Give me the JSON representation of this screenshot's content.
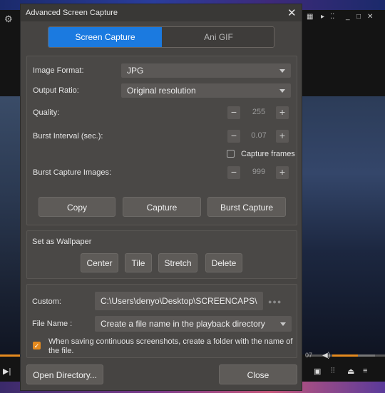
{
  "dialog": {
    "title": "Advanced Screen Capture",
    "close_glyph": "✕"
  },
  "tabs": [
    {
      "label": "Screen Capture",
      "active": true
    },
    {
      "label": "Ani GIF",
      "active": false
    }
  ],
  "capture": {
    "image_format_label": "Image Format:",
    "image_format_value": "JPG",
    "output_ratio_label": "Output Ratio:",
    "output_ratio_value": "Original resolution",
    "quality_label": "Quality:",
    "quality_value": "255",
    "burst_interval_label": "Burst Interval (sec.):",
    "burst_interval_value": "0.07",
    "capture_frames_label": "Capture frames",
    "capture_frames_checked": false,
    "burst_images_label": "Burst Capture Images:",
    "burst_images_value": "999",
    "minus_glyph": "−",
    "plus_glyph": "+",
    "copy_label": "Copy",
    "capture_label": "Capture",
    "burst_capture_label": "Burst Capture"
  },
  "wallpaper": {
    "heading": "Set as Wallpaper",
    "center_label": "Center",
    "tile_label": "Tile",
    "stretch_label": "Stretch",
    "delete_label": "Delete"
  },
  "output": {
    "custom_label": "Custom:",
    "custom_path": "C:\\Users\\denyo\\Desktop\\SCREENCAPS\\",
    "more_glyph": "●●●",
    "file_name_label": "File Name :",
    "file_name_value": "Create a file name in the playback directory",
    "folder_option_checked": true,
    "check_glyph": "✓",
    "folder_option_text": "When saving continuous screenshots, create a folder with the name of the file."
  },
  "footer": {
    "open_directory_label": "Open Directory...",
    "close_label": "Close"
  },
  "player": {
    "time_fragment": "07"
  },
  "colors": {
    "accent_blue": "#1b7ae0",
    "accent_orange": "#e48a1f",
    "dialog_bg": "#464442"
  }
}
